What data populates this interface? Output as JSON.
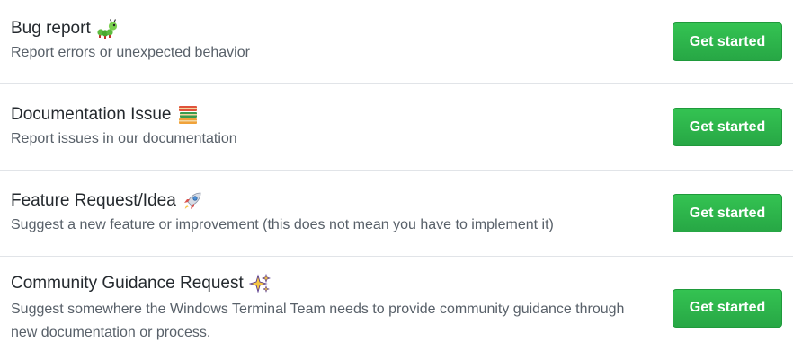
{
  "templates": [
    {
      "title": "Bug report",
      "description": "Report errors or unexpected behavior",
      "icon": "caterpillar-icon",
      "button_label": "Get started"
    },
    {
      "title": "Documentation Issue",
      "description": "Report issues in our documentation",
      "icon": "books-icon",
      "button_label": "Get started"
    },
    {
      "title": "Feature Request/Idea",
      "description": "Suggest a new feature or improvement (this does not mean you have to implement it)",
      "icon": "rocket-icon",
      "button_label": "Get started"
    },
    {
      "title": "Community Guidance Request",
      "description": "Suggest somewhere the Windows Terminal Team needs to provide community guidance through new documentation or process.",
      "icon": "sparkles-icon",
      "button_label": "Get started"
    }
  ],
  "colors": {
    "button_green": "#2ea44f",
    "title_text": "#24292e",
    "desc_text": "#586069",
    "divider": "#e1e4e8"
  }
}
